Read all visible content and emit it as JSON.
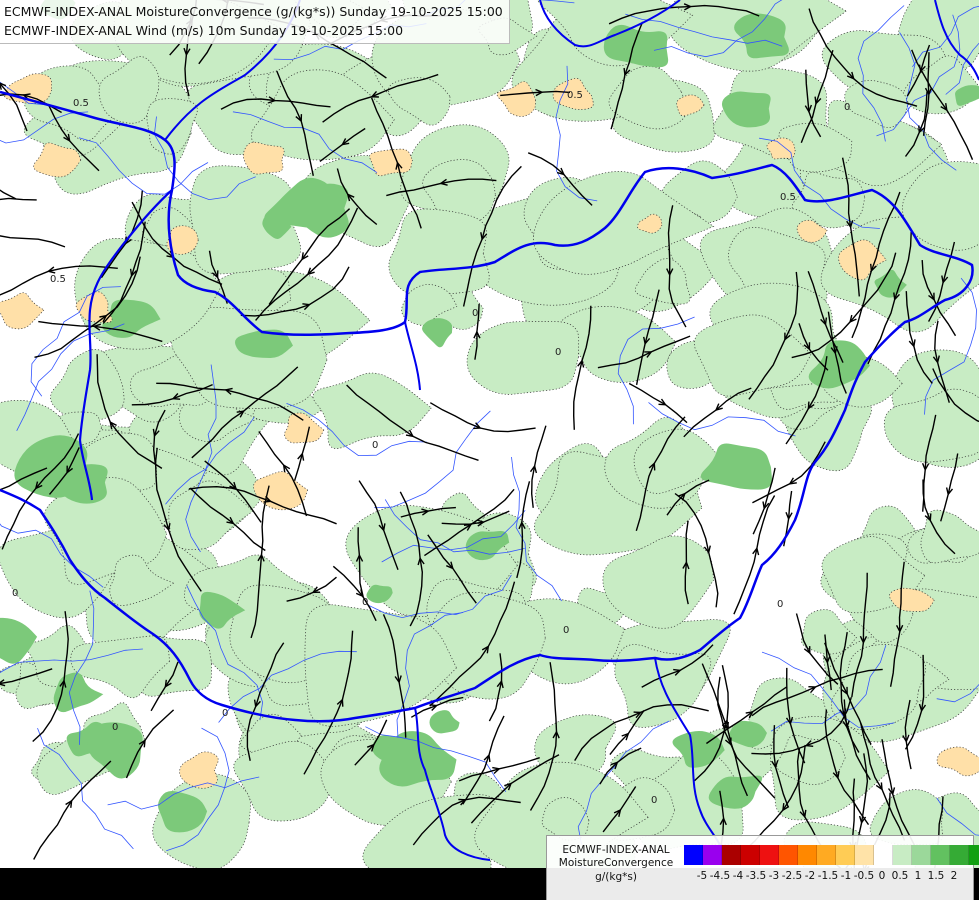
{
  "titles": {
    "line1": "ECMWF-INDEX-ANAL MoistureConvergence (g/(kg*s)) Sunday 19-10-2025 15:00",
    "line2": "ECMWF-INDEX-ANAL Wind (m/s) 10m Sunday 19-10-2025 15:00"
  },
  "legend": {
    "line1": "ECMWF-INDEX-ANAL",
    "line2": "MoistureConvergence",
    "unit": "g/(kg*s)",
    "colors": [
      "#0000ff",
      "#9900ee",
      "#aa0000",
      "#cc0000",
      "#ee1111",
      "#ff5500",
      "#ff8800",
      "#ffaa22",
      "#ffcc55",
      "#ffe3a8",
      "#ffffff",
      "#c8ecc4",
      "#9bd89a",
      "#62c160",
      "#35ab35",
      "#11a011"
    ],
    "ticks": [
      "-5",
      "-4.5",
      "-4",
      "-3.5",
      "-3",
      "-2.5",
      "-2",
      "-1.5",
      "-1",
      "-0.5",
      "0",
      "0.5",
      "1",
      "1.5",
      "2"
    ]
  },
  "contour_labels": [
    "0.5",
    "0.5",
    "0.5",
    "0.5",
    "0",
    "0",
    "0",
    "0",
    "0",
    "0",
    "0",
    "0",
    "0",
    "0",
    "0"
  ],
  "colors": {
    "border": "#0000ee",
    "river": "#3355ff",
    "streamline": "#000000",
    "positive": "#c8ecc4",
    "positive_strong": "#7cc97a",
    "negative": "#ffe0a8",
    "background": "#ffffff"
  }
}
